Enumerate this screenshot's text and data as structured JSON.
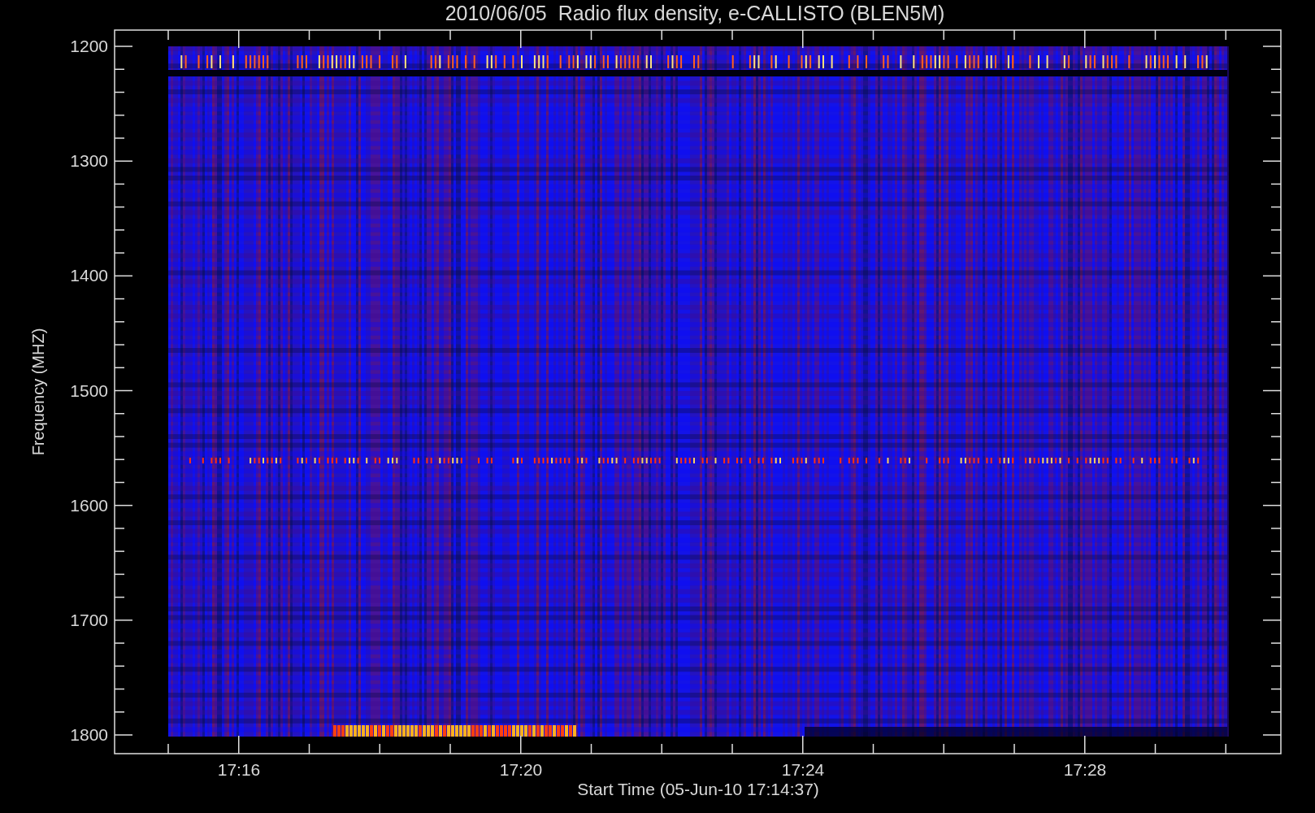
{
  "title": "2010/06/05  Radio flux density, e-CALLISTO (BLEN5M)",
  "y_axis": {
    "label": "Frequency (MHZ)",
    "ticks": [
      "1200",
      "1300",
      "1400",
      "1500",
      "1600",
      "1700",
      "1800"
    ]
  },
  "x_axis": {
    "label": "Start Time (05-Jun-10 17:14:37)",
    "ticks": [
      "17:16",
      "17:20",
      "17:24",
      "17:28"
    ]
  }
}
